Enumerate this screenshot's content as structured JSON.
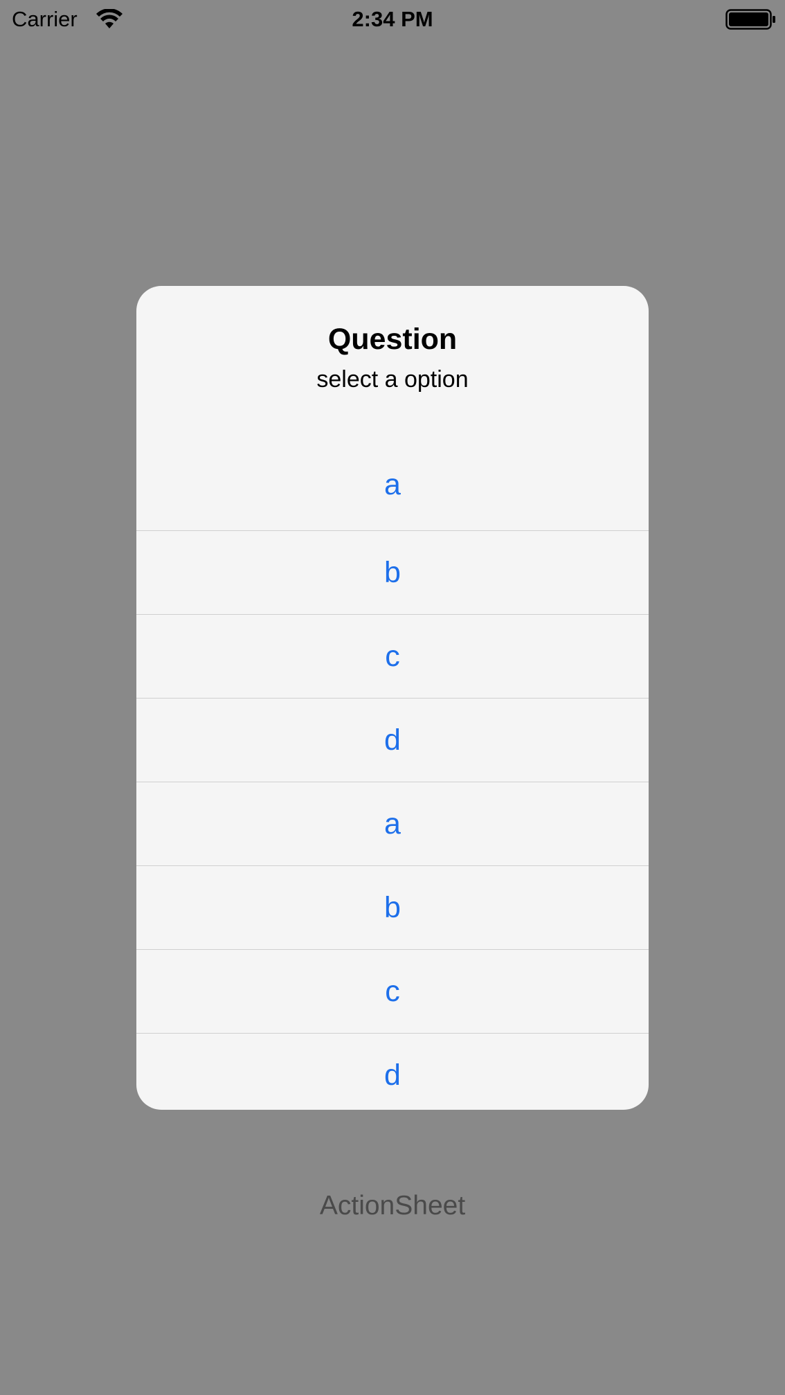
{
  "status_bar": {
    "carrier": "Carrier",
    "time": "2:34 PM",
    "wifi_icon": "wifi-icon",
    "battery_icon": "battery-icon"
  },
  "background": {
    "label": "ActionSheet"
  },
  "alert": {
    "title": "Question",
    "message": "select a option",
    "options": [
      "a",
      "b",
      "c",
      "d",
      "a",
      "b",
      "c",
      "d"
    ],
    "accent_color": "#1d6fea"
  }
}
